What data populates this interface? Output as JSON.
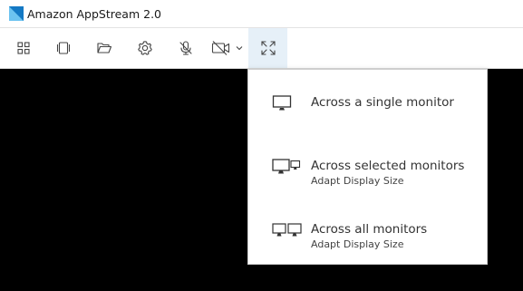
{
  "window": {
    "title": "Amazon AppStream 2.0"
  },
  "toolbar": {
    "buttons": [
      {
        "icon": "apps-grid-icon"
      },
      {
        "icon": "switch-windows-icon"
      },
      {
        "icon": "folder-open-icon"
      },
      {
        "icon": "gear-icon"
      },
      {
        "icon": "microphone-off-icon"
      },
      {
        "icon": "camera-off-icon"
      },
      {
        "icon": "fullscreen-expand-icon",
        "active": true
      }
    ],
    "accent": "#e6f0f8"
  },
  "fullscreen_menu": {
    "items": [
      {
        "label": "Across a single monitor",
        "sublabel": "",
        "icon": "single-monitor-icon"
      },
      {
        "label": "Across selected monitors",
        "sublabel": "Adapt Display Size",
        "icon": "selected-monitors-icon"
      },
      {
        "label": "Across all monitors",
        "sublabel": "Adapt Display Size",
        "icon": "all-monitors-icon"
      }
    ]
  }
}
